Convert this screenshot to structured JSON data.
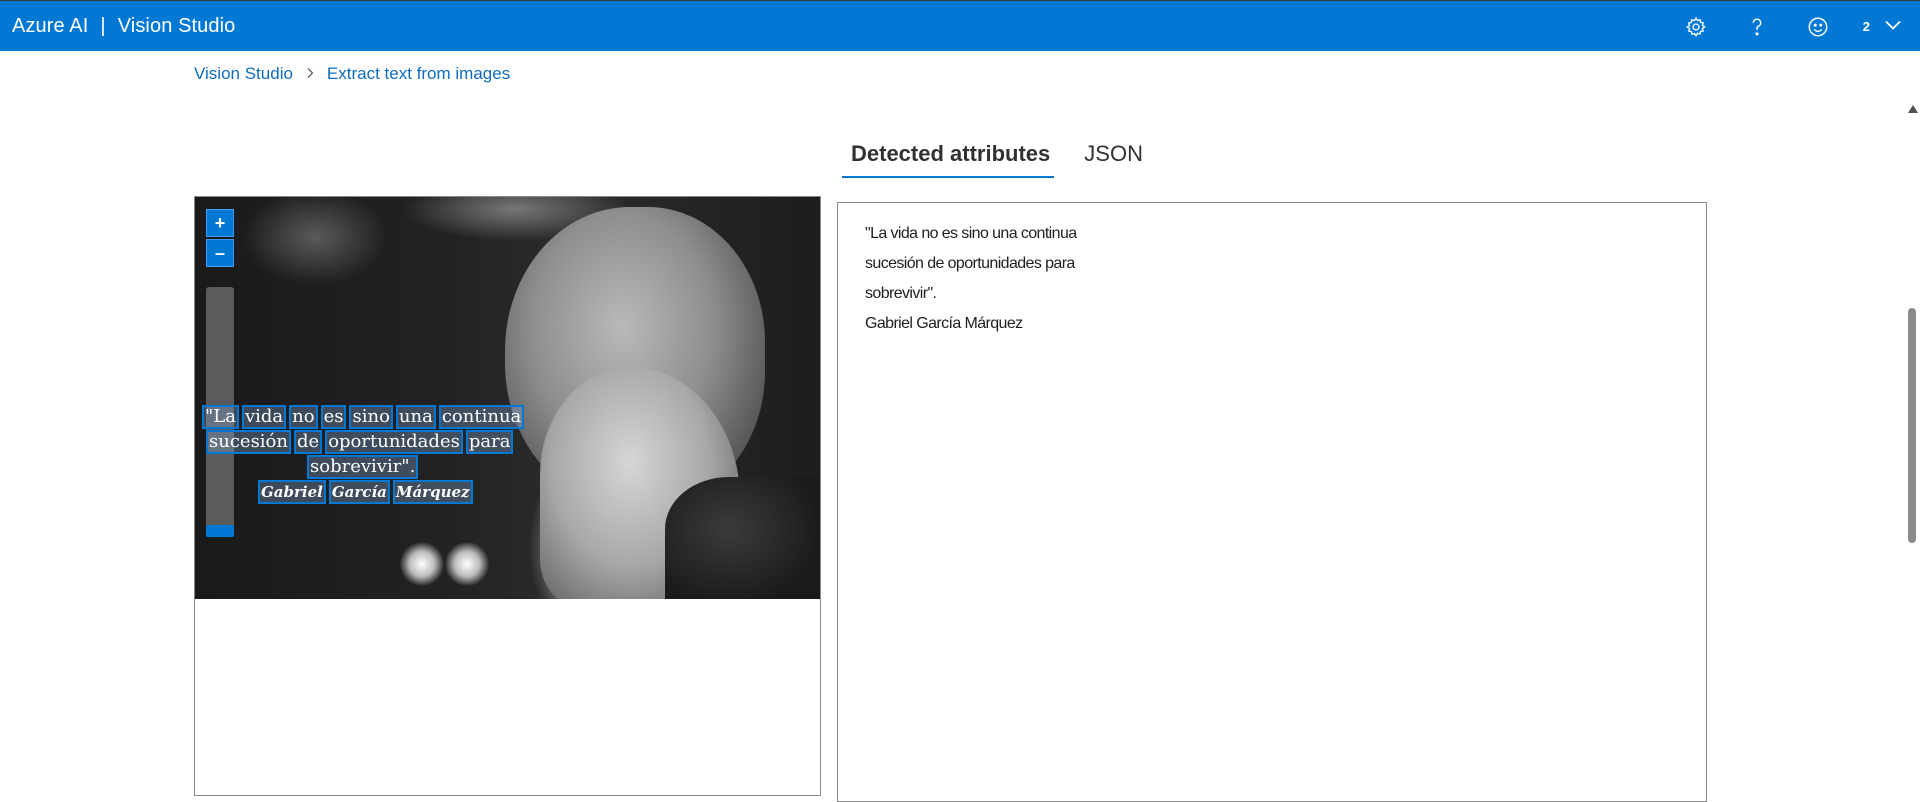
{
  "header": {
    "brand": "Azure AI",
    "separator": "|",
    "product": "Vision Studio",
    "account_count": "2",
    "icons": [
      "gear-icon",
      "help-icon",
      "feedback-smiley-icon",
      "chevron-down-icon"
    ]
  },
  "breadcrumb": {
    "items": [
      "Vision Studio",
      "Extract text from images"
    ],
    "separator": "›"
  },
  "tabs": {
    "items": [
      "Detected attributes",
      "JSON"
    ],
    "active": "Detected attributes"
  },
  "image_viewer": {
    "zoom_in_label": "+",
    "zoom_out_label": "–",
    "zoom_level": 0,
    "ocr_lines": [
      [
        "\"La",
        "vida",
        "no",
        "es",
        "sino",
        "una",
        "continua"
      ],
      [
        "sucesión",
        "de",
        "oportunidades",
        "para"
      ],
      [
        "sobrevivir\"."
      ],
      [
        "Gabriel",
        "García",
        "Márquez"
      ]
    ]
  },
  "detected_text": {
    "lines": [
      "\"La vida no es sino una continua",
      "sucesión de oportunidades para",
      "sobrevivir\".",
      "Gabriel García Márquez"
    ]
  },
  "colors": {
    "accent": "#0078d4",
    "link": "#0f6cbd"
  }
}
